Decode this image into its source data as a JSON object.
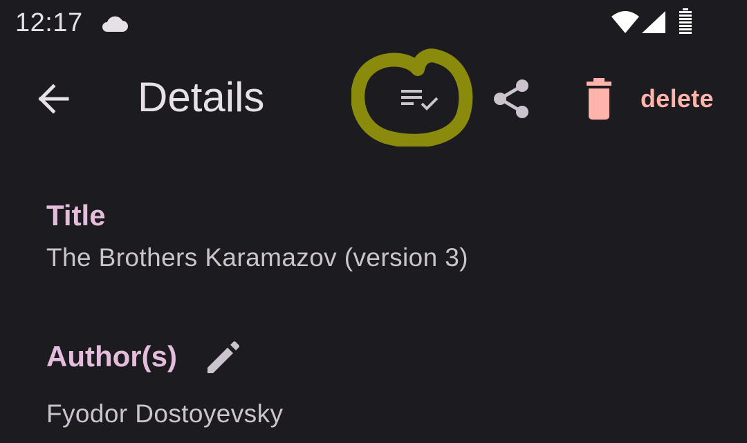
{
  "status_bar": {
    "time": "12:17",
    "icons": [
      "cloud-icon",
      "wifi-icon",
      "signal-icon",
      "battery-icon"
    ]
  },
  "app_bar": {
    "title": "Details",
    "back_icon": "arrow-back-icon",
    "actions": [
      {
        "icon": "checklist-icon",
        "highlighted": true
      },
      {
        "icon": "share-icon"
      },
      {
        "icon": "trash-icon",
        "label": "delete"
      }
    ]
  },
  "details": {
    "title_label": "Title",
    "title_value": "The Brothers Karamazov (version 3)",
    "authors_label": "Author(s)",
    "authors_edit_icon": "pencil-icon",
    "authors_value": "Fyodor Dostoyevsky"
  },
  "colors": {
    "background": "#1c1b20",
    "label": "#e4bcdc",
    "value": "#cbc4cf",
    "icon": "#cbc4cf",
    "delete": "#ffb4ab",
    "highlight": "#8a8a0c"
  }
}
